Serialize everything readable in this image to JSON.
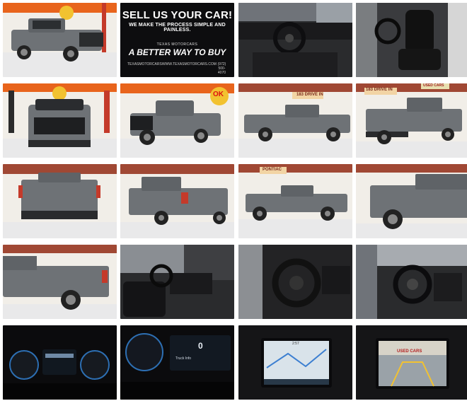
{
  "gallery": {
    "promo": {
      "headline": "SELL US YOUR CAR!",
      "subline": "WE MAKE THE PROCESS SIMPLE AND PAINLESS.",
      "brand": "TEXAS MOTORCARS",
      "tagline": "A BETTER WAY TO BUY",
      "footer_left": "TEXASMOTORCARS",
      "footer_url": "WWW.TEXASMOTORCARS.COM",
      "footer_phone": "(972) 500-4070"
    },
    "signs": {
      "ok": "OK",
      "drive_in": "183 DRIVE IN",
      "drive_in_2": "183 DRIVE IN",
      "used_cars": "USED CARS",
      "pontiac": "PONTIAC"
    },
    "cluster": {
      "speed_readout": "0",
      "info_line": "Truck Info"
    },
    "nav": {
      "time": "2:57"
    },
    "camera": {
      "sign": "USED CARS"
    },
    "colors": {
      "truck": "#6e7276",
      "floor": "#e9e9ea",
      "wall": "#f1eee8",
      "sign_orange": "#e8641c",
      "interior": "#1c1c1e",
      "promo_bg": "#0d0d0f"
    }
  }
}
